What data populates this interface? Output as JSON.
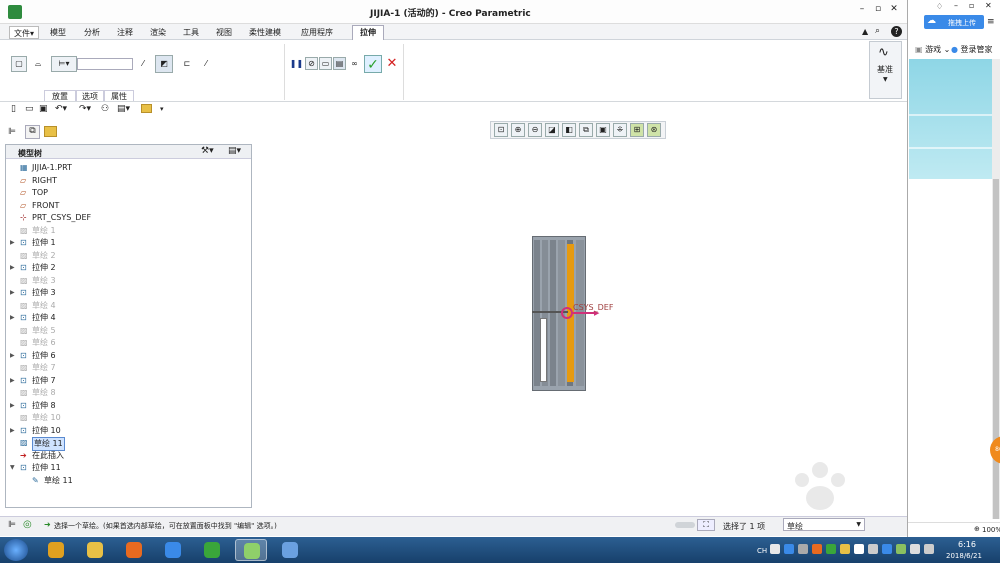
{
  "window": {
    "title": "JIJIA-1 (活动的) - Creo Parametric"
  },
  "menu": {
    "file": "文件▾",
    "tabs": [
      "模型",
      "分析",
      "注释",
      "渲染",
      "工具",
      "视图",
      "柔性建模",
      "应用程序"
    ],
    "active_tab": "拉伸"
  },
  "ribbon": {
    "subtabs": [
      "放置",
      "选项",
      "属性"
    ],
    "group": "基准"
  },
  "tree": {
    "title": "模型树",
    "items": [
      {
        "label": "JIJIA-1.PRT",
        "type": "root",
        "expand": ""
      },
      {
        "label": "RIGHT",
        "type": "plane",
        "expand": ""
      },
      {
        "label": "TOP",
        "type": "plane",
        "expand": ""
      },
      {
        "label": "FRONT",
        "type": "plane",
        "expand": ""
      },
      {
        "label": "PRT_CSYS_DEF",
        "type": "csys",
        "expand": ""
      },
      {
        "label": "草绘 1",
        "type": "sketch-dim",
        "expand": ""
      },
      {
        "label": "拉伸 1",
        "type": "extrude",
        "expand": "▶"
      },
      {
        "label": "草绘 2",
        "type": "sketch-dim",
        "expand": ""
      },
      {
        "label": "拉伸 2",
        "type": "extrude",
        "expand": "▶"
      },
      {
        "label": "草绘 3",
        "type": "sketch-dim",
        "expand": ""
      },
      {
        "label": "拉伸 3",
        "type": "extrude",
        "expand": "▶"
      },
      {
        "label": "草绘 4",
        "type": "sketch-dim",
        "expand": ""
      },
      {
        "label": "拉伸 4",
        "type": "extrude",
        "expand": "▶"
      },
      {
        "label": "草绘 5",
        "type": "sketch-dim",
        "expand": ""
      },
      {
        "label": "草绘 6",
        "type": "sketch-dim",
        "expand": ""
      },
      {
        "label": "拉伸 6",
        "type": "extrude",
        "expand": "▶"
      },
      {
        "label": "草绘 7",
        "type": "sketch-dim",
        "expand": ""
      },
      {
        "label": "拉伸 7",
        "type": "extrude",
        "expand": "▶"
      },
      {
        "label": "草绘 8",
        "type": "sketch-dim",
        "expand": ""
      },
      {
        "label": "拉伸 8",
        "type": "extrude",
        "expand": "▶"
      },
      {
        "label": "草绘 10",
        "type": "sketch-dim",
        "expand": ""
      },
      {
        "label": "拉伸 10",
        "type": "extrude",
        "expand": "▶"
      },
      {
        "label": "草绘 11",
        "type": "sketch-sel",
        "expand": ""
      },
      {
        "label": "在此插入",
        "type": "insert",
        "expand": ""
      },
      {
        "label": "拉伸 11",
        "type": "extrude",
        "expand": "▼"
      },
      {
        "label": "草绘 11",
        "type": "sketch-child",
        "expand": ""
      }
    ]
  },
  "viewport": {
    "csys_label": "CSYS_DEF"
  },
  "status": {
    "message": "选择一个草绘。(如果首选内部草绘，可在放置面板中找到 \"编辑\" 选项。)",
    "selected": "选择了 1 项",
    "filter": "草绘"
  },
  "side": {
    "upload": "拖拽上传",
    "games": "游戏",
    "login": "登录管家",
    "zoom": "100%"
  },
  "taskbar": {
    "lang": "CH",
    "time": "6:16",
    "date": "2018/6/21"
  },
  "colors": {
    "accent": "#d4a017",
    "taskbar": "#1b4a7a",
    "ok": "#2aa02a",
    "cancel": "#d42020"
  }
}
